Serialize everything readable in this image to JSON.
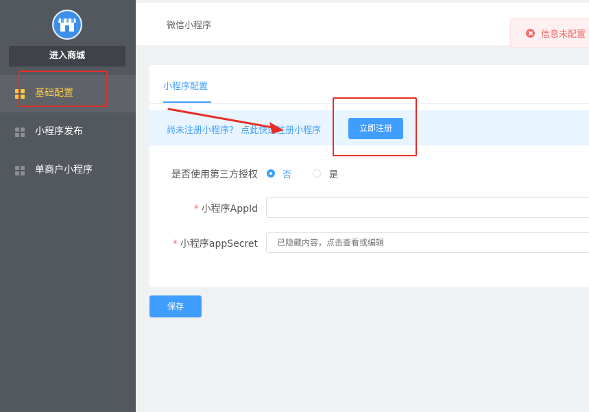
{
  "sidebar": {
    "enter_mall": "进入商城",
    "items": [
      {
        "label": "基础配置",
        "icon": "grid-icon",
        "active": true
      },
      {
        "label": "小程序发布",
        "icon": "grid-icon",
        "active": false
      },
      {
        "label": "单商户小程序",
        "icon": "grid-icon",
        "active": false
      }
    ]
  },
  "header": {
    "breadcrumb": "微信小程序"
  },
  "notice": {
    "text": "信息未配置",
    "icon": "error-circle-icon"
  },
  "card": {
    "tab": "小程序配置",
    "info": {
      "text": "尚未注册小程序？ 点此快速注册小程序",
      "button": "立即注册"
    },
    "form": {
      "third_party": {
        "label": "是否使用第三方授权",
        "options": [
          "否",
          "是"
        ],
        "selected": "否"
      },
      "appid": {
        "label": "小程序AppId",
        "required_mark": "*",
        "value": "",
        "placeholder": ""
      },
      "appsecret": {
        "label": "小程序appSecret",
        "required_mark": "*",
        "value": "",
        "placeholder": "已隐藏内容，点击查看或编辑"
      }
    }
  },
  "save_button": "保存",
  "colors": {
    "sidebar_bg": "#53575e",
    "active_text": "#f7c945",
    "primary": "#409eff",
    "error": "#f56c6c",
    "annotation": "#e52d27"
  }
}
